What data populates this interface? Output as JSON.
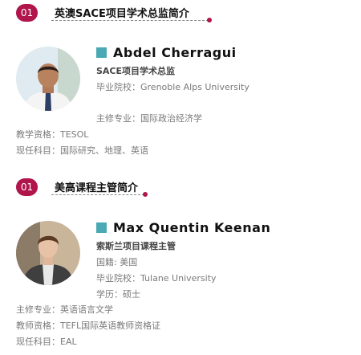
{
  "sections": [
    {
      "number": "01",
      "heading": "英澳SACE项目学术总监简介",
      "name": "Abdel Cherragui",
      "role": "SACE项目学术总监",
      "details": [
        "毕业院校：Grenoble Alps University",
        "主修专业：国际政治经济学",
        "教学资格：TESOL",
        "现任科目：国际研究、地理、英语"
      ]
    },
    {
      "number": "01",
      "heading": "美高课程主管简介",
      "name": "Max Quentin Keenan",
      "role": "索斯兰项目课程主管",
      "details": [
        "国籍: 美国",
        "毕业院校：Tulane University",
        "学历：硕士",
        "主修专业：英语语言文学",
        "教师资格：TEFL国际英语教师资格证",
        "现任科目：EAL"
      ]
    }
  ],
  "colors": {
    "badge": "#b0154b",
    "name_square": "#4aa9b4"
  },
  "icons": [
    "avatar-abdel-photo",
    "avatar-max-photo"
  ]
}
